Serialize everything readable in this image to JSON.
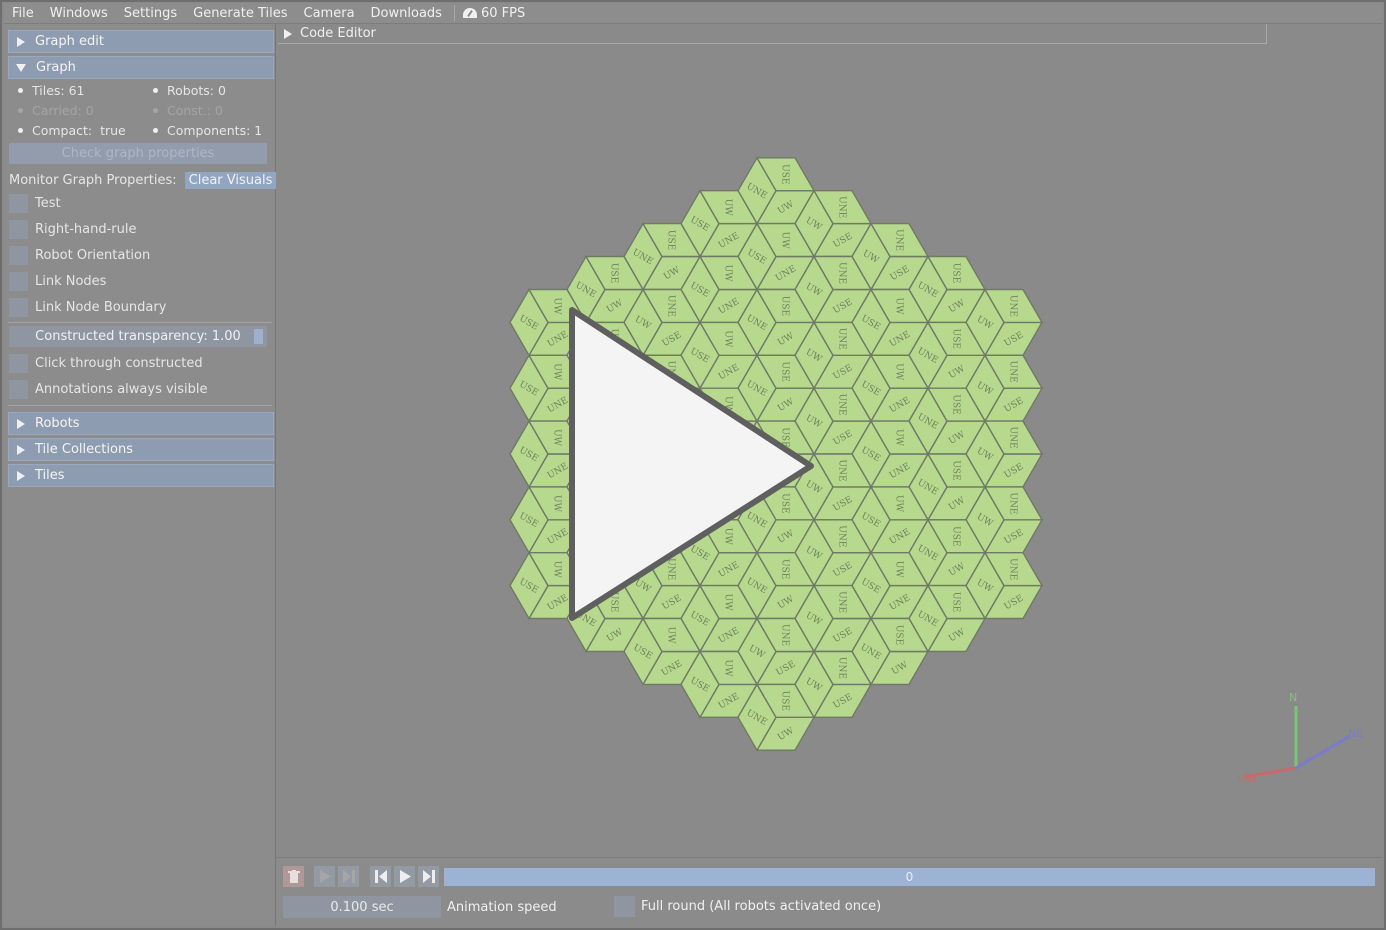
{
  "menu": {
    "items": [
      "File",
      "Windows",
      "Settings",
      "Generate Tiles",
      "Camera",
      "Downloads"
    ],
    "fps": "60 FPS"
  },
  "sidebar": {
    "graph_edit": "Graph edit",
    "graph": "Graph",
    "stats": {
      "tiles": "Tiles: 61",
      "robots": "Robots: 0",
      "carried": "Carried: 0",
      "const": "Const.: 0",
      "compact": "Compact:  true",
      "components": "Components: 1"
    },
    "check_button": "Check graph properties",
    "monitor_label": "Monitor Graph Properties:",
    "clear_visuals": "Clear Visuals",
    "checks": [
      "Test",
      "Right-hand-rule",
      "Robot Orientation",
      "Link Nodes",
      "Link Node Boundary"
    ],
    "transparency": "Constructed transparency: 1.00",
    "transparency_value": 1.0,
    "click_through": "Click through constructed",
    "annotations": "Annotations always visible",
    "sections": [
      "Robots",
      "Tile Collections",
      "Tiles"
    ]
  },
  "code_editor": "Code Editor",
  "viewport": {
    "tile_labels": [
      "UW",
      "UNE",
      "USE"
    ],
    "axes": {
      "n": "N",
      "uw": "UW",
      "ne": "NE"
    },
    "colors": {
      "tile": "#b6d98e",
      "background": "#8a8a8a"
    }
  },
  "bottom": {
    "timeline_value": "0",
    "speed": "0.100 sec",
    "speed_label": "Animation speed",
    "full_round": "Full round (All robots activated once)"
  }
}
